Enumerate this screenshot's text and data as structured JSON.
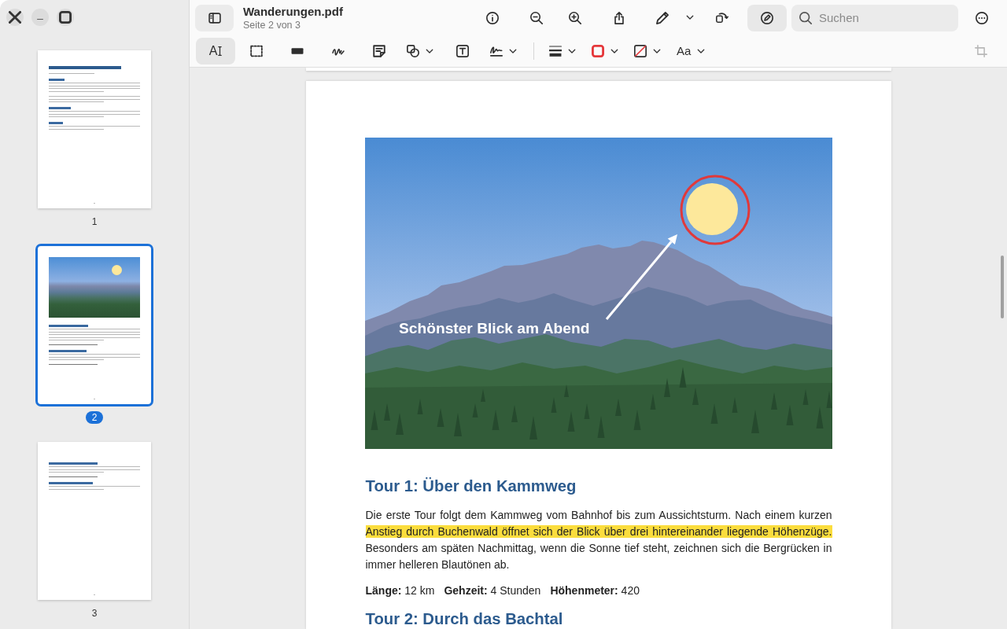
{
  "window": {
    "title": "Wanderungen.pdf",
    "subtitle": "Seite 2 von 3"
  },
  "sidebar": {
    "pages": [
      {
        "label": "1",
        "kind": "title-page",
        "selected": false
      },
      {
        "label": "2",
        "kind": "image-page",
        "selected": true
      },
      {
        "label": "3",
        "kind": "text-page",
        "selected": false
      }
    ]
  },
  "header": {
    "annotate": {
      "on": true
    },
    "search": {
      "placeholder": "Suchen"
    }
  },
  "toolbar": {
    "tools": [
      {
        "kind": "text-select",
        "glyph": "A",
        "selected": true,
        "dropdown": false
      },
      {
        "kind": "area-select",
        "selected": false,
        "dropdown": false
      },
      {
        "kind": "redact",
        "selected": false,
        "dropdown": false
      },
      {
        "kind": "freehand",
        "selected": false,
        "dropdown": false
      },
      {
        "kind": "note",
        "selected": false,
        "dropdown": false
      },
      {
        "kind": "shapes",
        "selected": false,
        "dropdown": true
      },
      {
        "kind": "text-box",
        "selected": false,
        "dropdown": false
      },
      {
        "kind": "signature",
        "selected": false,
        "dropdown": true
      }
    ],
    "style_options": [
      {
        "kind": "line-width"
      },
      {
        "kind": "stroke-color",
        "color": "#e5383b"
      },
      {
        "kind": "fill-color"
      },
      {
        "kind": "font",
        "glyph": "Aa"
      }
    ],
    "crop": {
      "disabled": true
    }
  },
  "document": {
    "figure": {
      "label": "Schönster Blick am Abend"
    },
    "heading": "Tour 1: Über den Kammweg",
    "paragraph": [
      {
        "text": "Die erste Tour folgt dem Kammweg vom Bahnhof bis zum Aussichtsturm. Nach einem kurzen",
        "highlighted": false
      },
      {
        "text": "Anstieg durch Buchenwald öffnet sich der Blick über drei hintereinander liegende Höhenzüge.",
        "highlighted": true
      },
      {
        "text": "Besonders am späten Nachmittag, wenn die Sonne tief steht, zeichnen sich die Bergrücken in immer helleren Blautönen ab.",
        "highlighted": false
      }
    ],
    "facts": [
      "**Länge:** 12 km",
      "**Gehzeit:** 4 Stunden",
      "**Höhenmeter:** 420"
    ],
    "next_heading": "Tour 2: Durch das Bachtal"
  }
}
